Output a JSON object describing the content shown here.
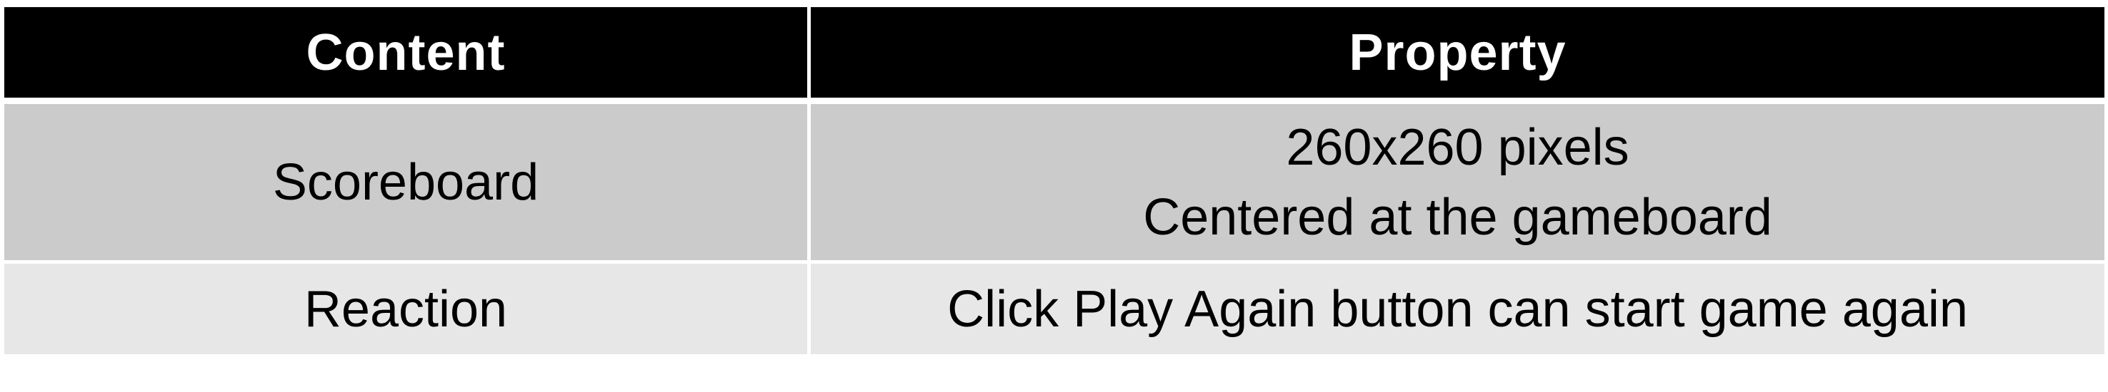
{
  "table": {
    "headers": [
      "Content",
      "Property"
    ],
    "rows": [
      {
        "content": "Scoreboard",
        "property_lines": [
          "260x260 pixels",
          "Centered at the gameboard"
        ]
      },
      {
        "content": "Reaction",
        "property_lines": [
          "Click Play Again button can start game again"
        ]
      }
    ]
  },
  "colors": {
    "header_bg": "#000000",
    "header_text": "#ffffff",
    "row_1_bg": "#cbcbcb",
    "row_2_bg": "#e7e7e7",
    "cell_text": "#000000"
  }
}
